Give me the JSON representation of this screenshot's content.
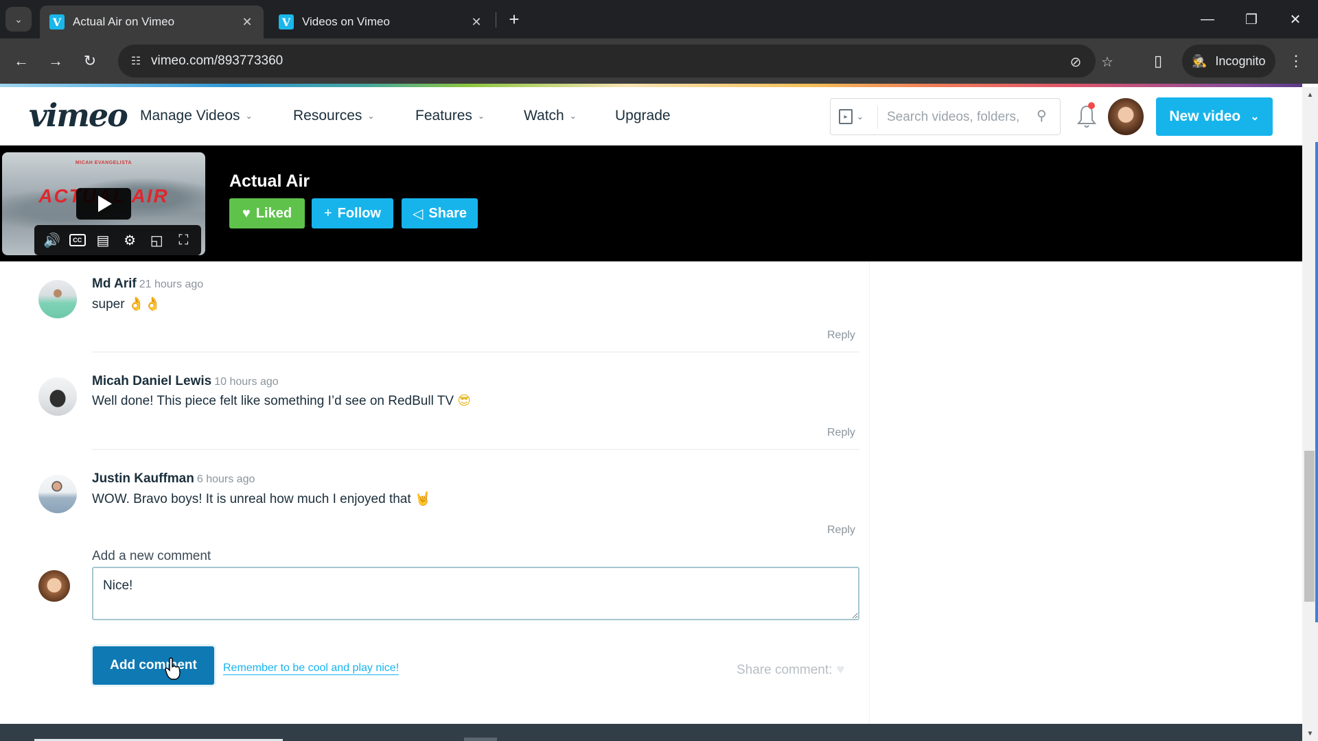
{
  "browser": {
    "tabs": [
      {
        "title": "Actual Air on Vimeo",
        "favicon": "vimeo-v",
        "active": true
      },
      {
        "title": "Videos on Vimeo",
        "favicon": "vimeo-v",
        "active": false
      }
    ],
    "url": "vimeo.com/893773360",
    "incognito_label": "Incognito",
    "icons": {
      "back": "←",
      "forward": "→",
      "reload": "↻",
      "site_info": "☷",
      "eye_off": "⊘",
      "star": "☆",
      "sidepanel": "▯",
      "menu": "⋮",
      "minimize": "—",
      "restore": "❐",
      "close": "✕",
      "new_tab": "+",
      "tab_close": "✕",
      "tab_search": "⌄"
    }
  },
  "vimeo_header": {
    "logo": "vimeo",
    "nav": [
      {
        "label": "Manage Videos",
        "has_dropdown": true
      },
      {
        "label": "Resources",
        "has_dropdown": true
      },
      {
        "label": "Features",
        "has_dropdown": true
      },
      {
        "label": "Watch",
        "has_dropdown": true
      },
      {
        "label": "Upgrade",
        "has_dropdown": false
      }
    ],
    "search_placeholder": "Search videos, folders,",
    "new_video_label": "New video",
    "chevron": "⌄",
    "notification_badge": true
  },
  "video": {
    "title": "Actual Air",
    "thumbnail_title": "ACTUAL AIR",
    "thumbnail_credit": "MICAH EVANGELISTA",
    "buttons": {
      "liked": "Liked",
      "follow": "Follow",
      "share": "Share"
    },
    "icons": {
      "heart": "♥",
      "plus": "+",
      "share": "◁"
    },
    "controls": [
      "volume-icon",
      "captions-icon",
      "transcript-icon",
      "settings-icon",
      "pip-icon",
      "fullscreen-icon"
    ],
    "control_glyphs": {
      "volume": "🔊",
      "cc": "CC",
      "transcript": "▤",
      "settings": "⚙",
      "pip": "◱",
      "fullscreen": "⛶"
    }
  },
  "comments": [
    {
      "author": "Md Arif",
      "time": "21 hours ago",
      "text": "super",
      "emoji": "👌👌",
      "reply": "Reply"
    },
    {
      "author": "Micah Daniel Lewis",
      "time": "10 hours ago",
      "text": "Well done! This piece felt like something I’d see on RedBull TV",
      "emoji": "😎",
      "reply": "Reply"
    },
    {
      "author": "Justin Kauffman",
      "time": "6 hours ago",
      "text": "WOW. Bravo boys! It is unreal how much I enjoyed that",
      "emoji": "🤘",
      "reply": "Reply"
    }
  ],
  "new_comment": {
    "label": "Add a new comment",
    "value": "Nice!",
    "submit_label": "Add comment",
    "guideline_link": "Remember to be cool and play nice!",
    "share_label": "Share comment:",
    "share_icon": "♥"
  },
  "colors": {
    "vimeo_blue": "#17b4ec",
    "liked_green": "#5fc24b",
    "add_comment_blue": "#0f79b3",
    "text_dark": "#1a2e3b",
    "muted": "#8a949c"
  }
}
